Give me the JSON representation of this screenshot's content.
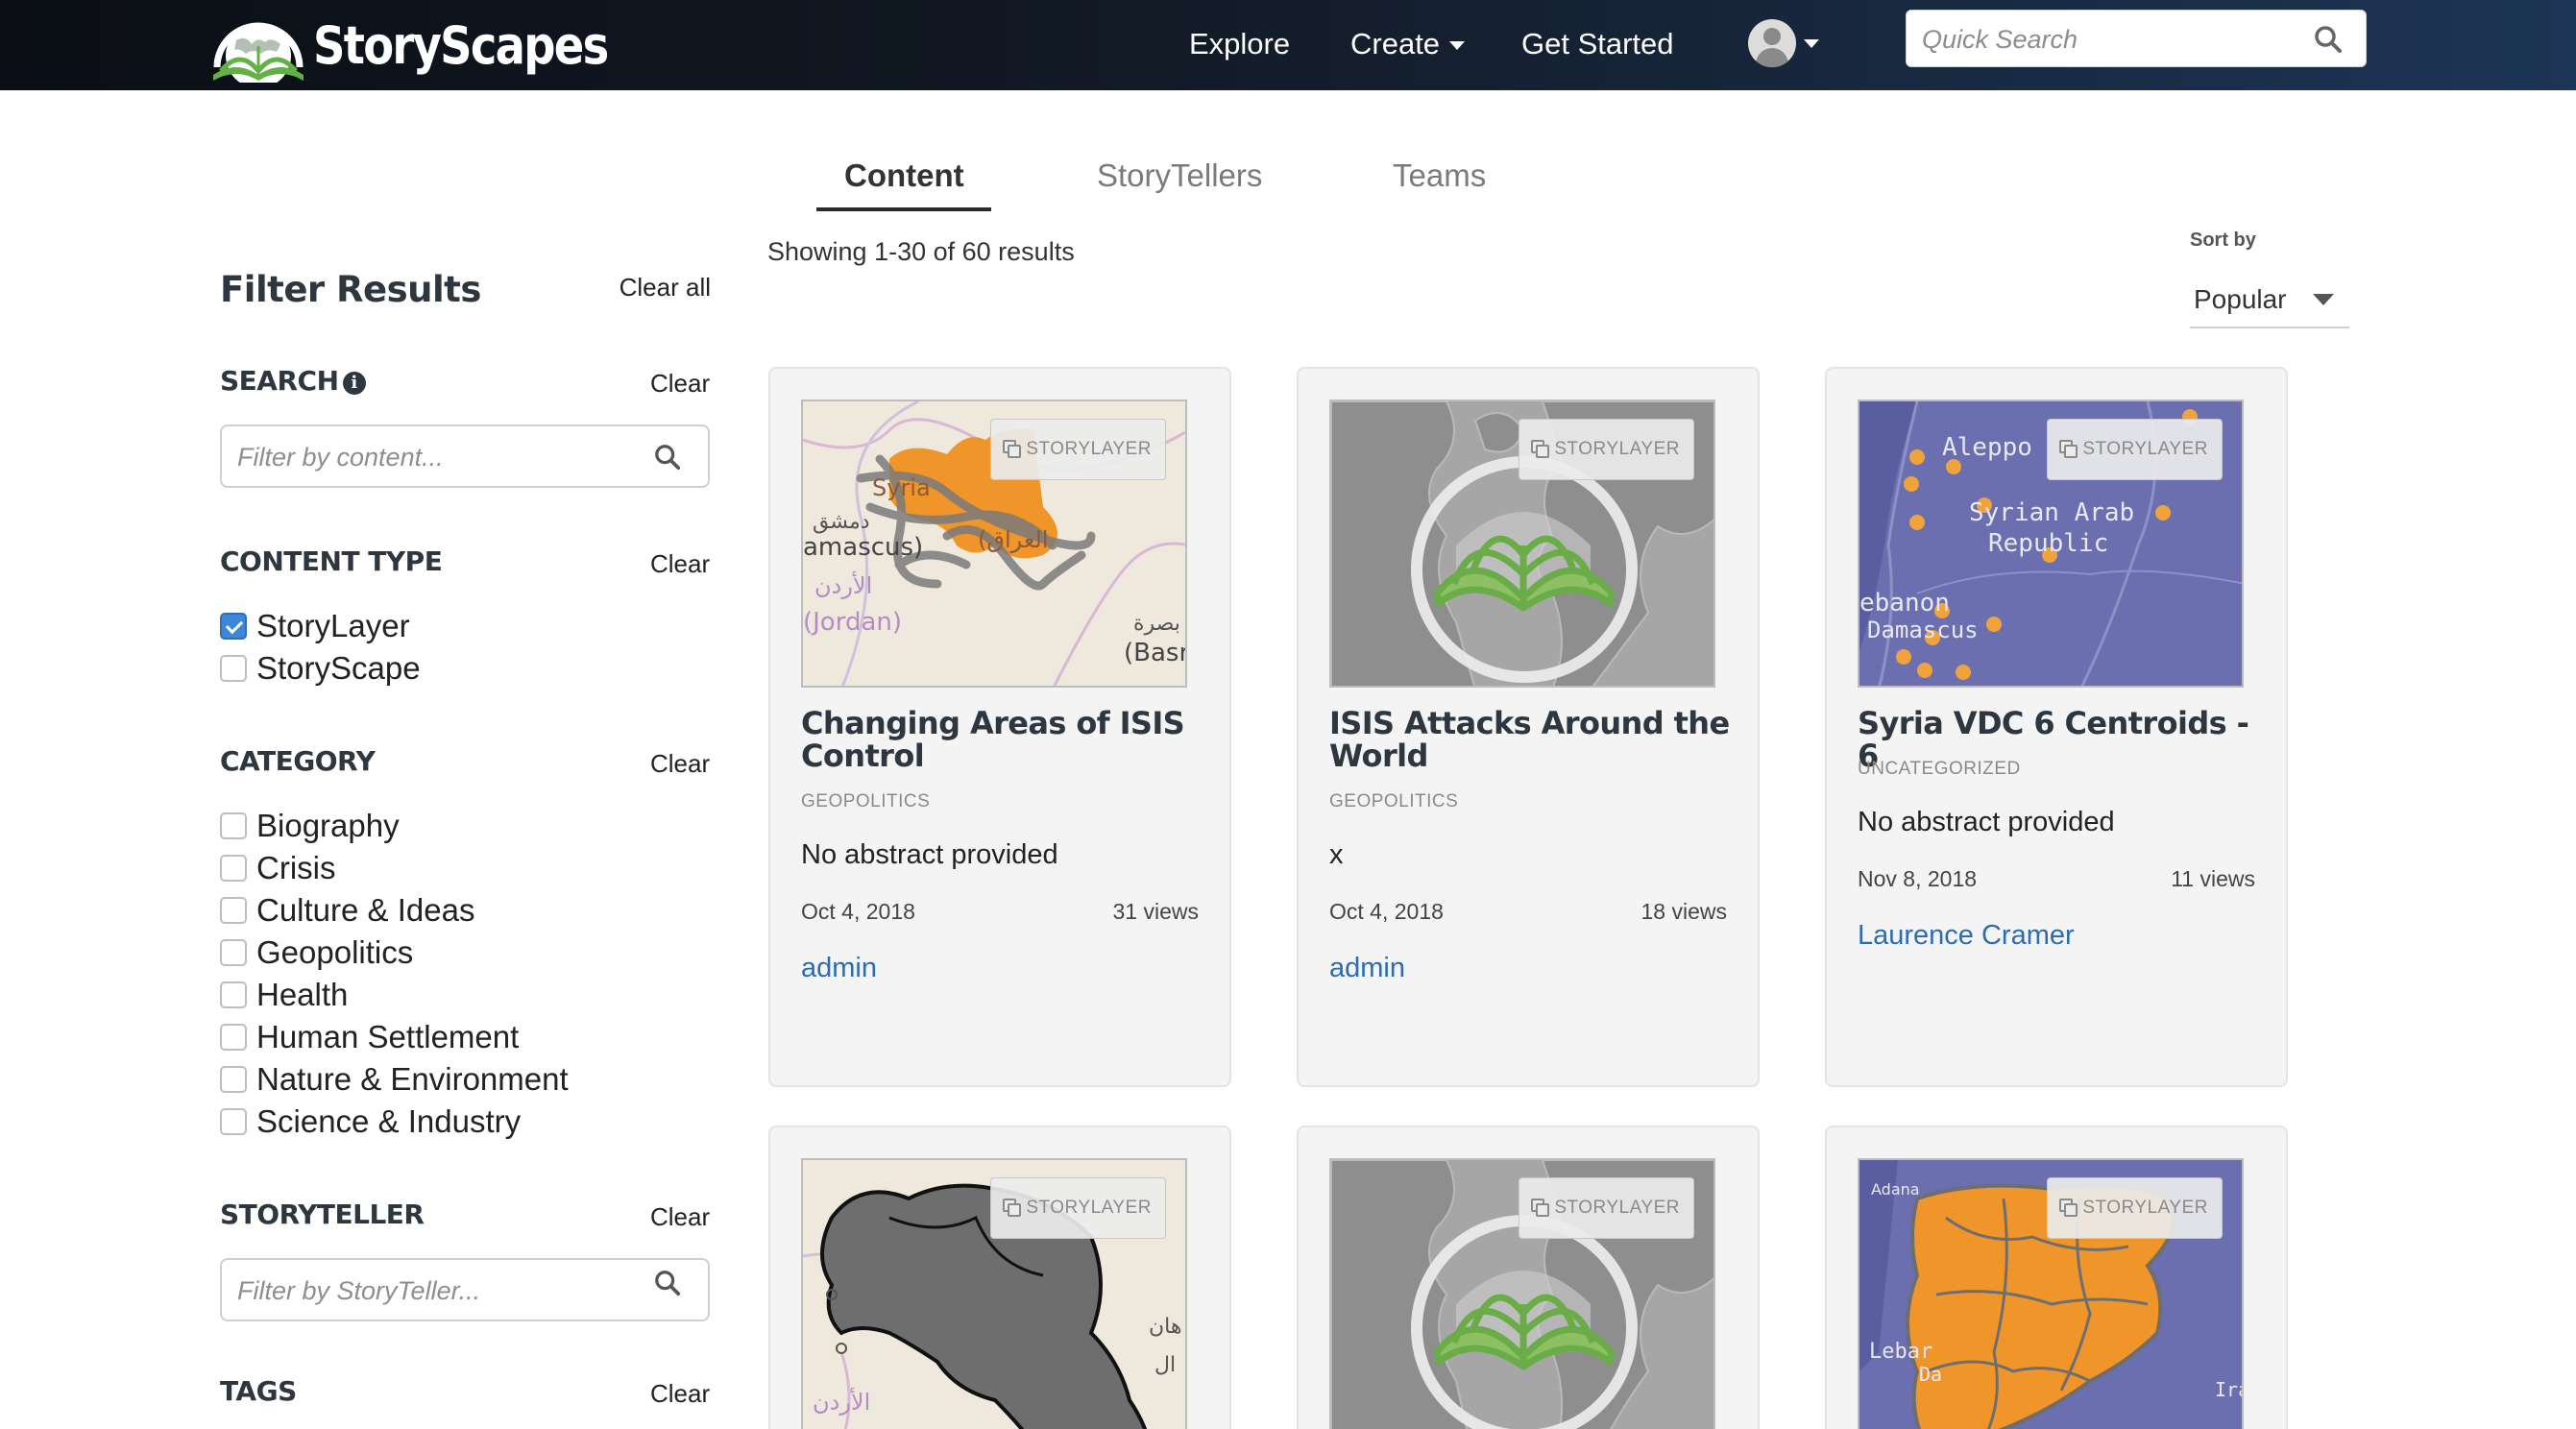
{
  "brand": {
    "name": "StoryScapes"
  },
  "nav": {
    "explore": "Explore",
    "create": "Create",
    "get_started": "Get Started"
  },
  "search": {
    "placeholder": "Quick Search"
  },
  "tabs": [
    {
      "label": "Content",
      "active": true
    },
    {
      "label": "StoryTellers",
      "active": false
    },
    {
      "label": "Teams",
      "active": false
    }
  ],
  "results": {
    "showing": "Showing 1-30 of 60 results"
  },
  "sort": {
    "label": "Sort by",
    "value": "Popular"
  },
  "sidebar": {
    "title": "Filter Results",
    "clear_all": "Clear all",
    "clear": "Clear",
    "search": {
      "heading": "SEARCH",
      "placeholder": "Filter by content..."
    },
    "content_type": {
      "heading": "CONTENT TYPE",
      "options": [
        {
          "label": "StoryLayer",
          "checked": true
        },
        {
          "label": "StoryScape",
          "checked": false
        }
      ]
    },
    "category": {
      "heading": "CATEGORY",
      "options": [
        {
          "label": "Biography",
          "checked": false
        },
        {
          "label": "Crisis",
          "checked": false
        },
        {
          "label": "Culture & Ideas",
          "checked": false
        },
        {
          "label": "Geopolitics",
          "checked": false
        },
        {
          "label": "Health",
          "checked": false
        },
        {
          "label": "Human Settlement",
          "checked": false
        },
        {
          "label": "Nature & Environment",
          "checked": false
        },
        {
          "label": "Science & Industry",
          "checked": false
        }
      ]
    },
    "storyteller": {
      "heading": "STORYTELLER",
      "placeholder": "Filter by StoryTeller..."
    },
    "tags": {
      "heading": "TAGS"
    }
  },
  "cards": [
    {
      "badge": "STORYLAYER",
      "title_line1": "Changing Areas of ISIS",
      "title_line2": "Control",
      "category": "GEOPOLITICS",
      "abstract": "No abstract provided",
      "date": "Oct 4, 2018",
      "views": "31 views",
      "author": "admin",
      "map_labels": [
        "Syria",
        "دمشق",
        "amascus)",
        "(العراق",
        "الأردن",
        "(Jordan)",
        "بصرة",
        "(Basr"
      ]
    },
    {
      "badge": "STORYLAYER",
      "title_line1": "ISIS Attacks Around the",
      "title_line2": "World",
      "category": "GEOPOLITICS",
      "abstract": "x",
      "date": "Oct 4, 2018",
      "views": "18 views",
      "author": "admin"
    },
    {
      "badge": "STORYLAYER",
      "title_line1": "Syria VDC 6 Centroids - 6",
      "title_line2": "",
      "category": "UNCATEGORIZED",
      "abstract": "No abstract provided",
      "date": "Nov 8, 2018",
      "views": "11 views",
      "author": "Laurence Cramer",
      "map_labels": [
        "Aleppo",
        "Syrian Arab",
        "Republic",
        "ebanon",
        "Damascus"
      ]
    },
    {
      "badge": "STORYLAYER",
      "map_labels": [
        "الأردن",
        "هان",
        "ال"
      ]
    },
    {
      "badge": "STORYLAYER"
    },
    {
      "badge": "STORYLAYER",
      "map_labels": [
        "Adana",
        "Lebar",
        "Da",
        "Ira"
      ]
    }
  ],
  "colors": {
    "accent": "#3b87d9",
    "link": "#2b6cb3",
    "orange": "#f0952a",
    "map_purple": "#6b6fb0"
  }
}
